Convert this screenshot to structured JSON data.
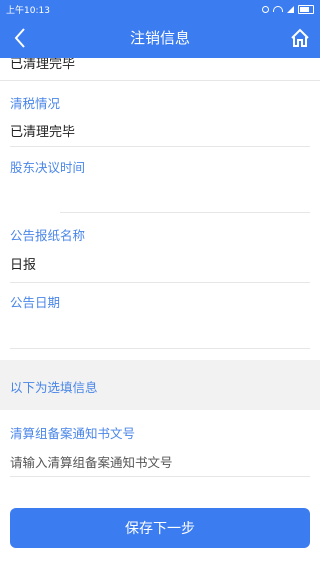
{
  "status_bar": {
    "time": "上午10:13"
  },
  "nav": {
    "title": "注销信息"
  },
  "fields": {
    "top_value": "已清理完毕",
    "tax_label": "清税情况",
    "tax_value": "已清理完毕",
    "resolution_label": "股东决议时间",
    "resolution_value": "",
    "newspaper_label": "公告报纸名称",
    "newspaper_value": "日报",
    "announce_label": "公告日期",
    "announce_value": ""
  },
  "optional_section": {
    "title": "以下为选填信息"
  },
  "liquidation": {
    "label": "清算组备案通知书文号",
    "placeholder": "请输入清算组备案通知书文号"
  },
  "footer": {
    "submit_label": "保存下一步"
  }
}
